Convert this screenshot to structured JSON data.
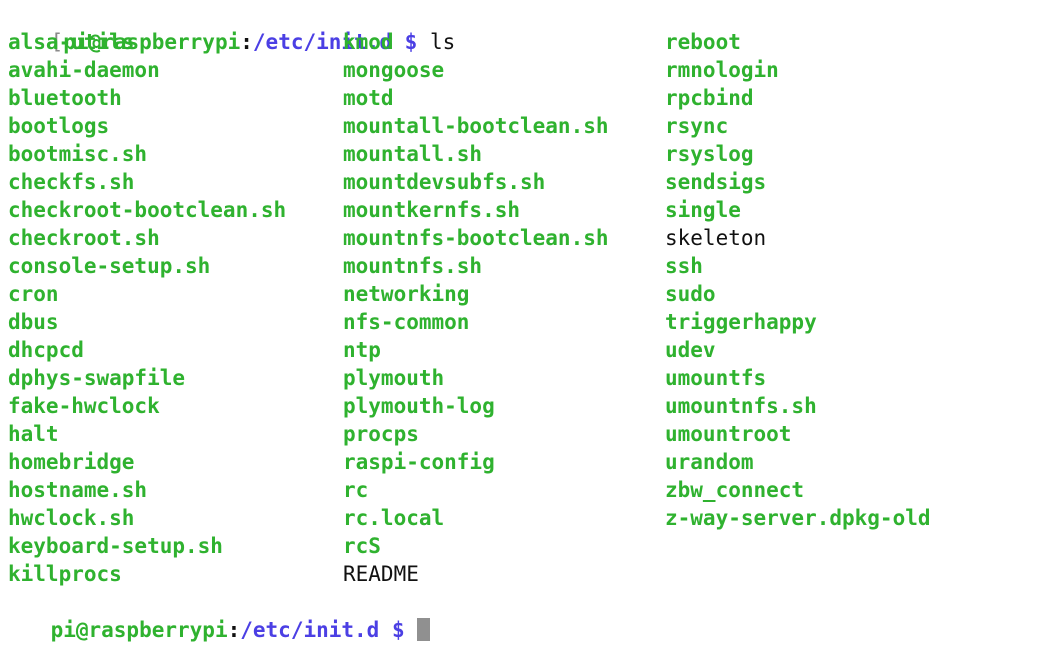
{
  "terminal": {
    "background_color": "#ffffff",
    "exec_color": "#2fb22f",
    "plain_color": "#111111",
    "path_color": "#4b3fe4",
    "cursor_color": "#909090",
    "bracket_color": "#8a8a8a"
  },
  "top_prompt": {
    "bracket": "[",
    "user_host": "pi@raspberrypi",
    "colon": ":",
    "path": "/etc/init.d",
    "space": " ",
    "dollar": "$",
    "command": " ls"
  },
  "bottom_prompt": {
    "user_host": "pi@raspberrypi",
    "colon": ":",
    "path": "/etc/init.d",
    "space": " ",
    "dollar": "$",
    "command": " "
  },
  "listing": {
    "columns": [
      {
        "name": "column-1",
        "entries": [
          {
            "text": "alsa-utils",
            "type": "exec"
          },
          {
            "text": "avahi-daemon",
            "type": "exec"
          },
          {
            "text": "bluetooth",
            "type": "exec"
          },
          {
            "text": "bootlogs",
            "type": "exec"
          },
          {
            "text": "bootmisc.sh",
            "type": "exec"
          },
          {
            "text": "checkfs.sh",
            "type": "exec"
          },
          {
            "text": "checkroot-bootclean.sh",
            "type": "exec"
          },
          {
            "text": "checkroot.sh",
            "type": "exec"
          },
          {
            "text": "console-setup.sh",
            "type": "exec"
          },
          {
            "text": "cron",
            "type": "exec"
          },
          {
            "text": "dbus",
            "type": "exec"
          },
          {
            "text": "dhcpcd",
            "type": "exec"
          },
          {
            "text": "dphys-swapfile",
            "type": "exec"
          },
          {
            "text": "fake-hwclock",
            "type": "exec"
          },
          {
            "text": "halt",
            "type": "exec"
          },
          {
            "text": "homebridge",
            "type": "exec"
          },
          {
            "text": "hostname.sh",
            "type": "exec"
          },
          {
            "text": "hwclock.sh",
            "type": "exec"
          },
          {
            "text": "keyboard-setup.sh",
            "type": "exec"
          },
          {
            "text": "killprocs",
            "type": "exec"
          }
        ]
      },
      {
        "name": "column-2",
        "entries": [
          {
            "text": "kmod",
            "type": "exec"
          },
          {
            "text": "mongoose",
            "type": "exec"
          },
          {
            "text": "motd",
            "type": "exec"
          },
          {
            "text": "mountall-bootclean.sh",
            "type": "exec"
          },
          {
            "text": "mountall.sh",
            "type": "exec"
          },
          {
            "text": "mountdevsubfs.sh",
            "type": "exec"
          },
          {
            "text": "mountkernfs.sh",
            "type": "exec"
          },
          {
            "text": "mountnfs-bootclean.sh",
            "type": "exec"
          },
          {
            "text": "mountnfs.sh",
            "type": "exec"
          },
          {
            "text": "networking",
            "type": "exec"
          },
          {
            "text": "nfs-common",
            "type": "exec"
          },
          {
            "text": "ntp",
            "type": "exec"
          },
          {
            "text": "plymouth",
            "type": "exec"
          },
          {
            "text": "plymouth-log",
            "type": "exec"
          },
          {
            "text": "procps",
            "type": "exec"
          },
          {
            "text": "raspi-config",
            "type": "exec"
          },
          {
            "text": "rc",
            "type": "exec"
          },
          {
            "text": "rc.local",
            "type": "exec"
          },
          {
            "text": "rcS",
            "type": "exec"
          },
          {
            "text": "README",
            "type": "plain"
          }
        ]
      },
      {
        "name": "column-3",
        "entries": [
          {
            "text": "reboot",
            "type": "exec"
          },
          {
            "text": "rmnologin",
            "type": "exec"
          },
          {
            "text": "rpcbind",
            "type": "exec"
          },
          {
            "text": "rsync",
            "type": "exec"
          },
          {
            "text": "rsyslog",
            "type": "exec"
          },
          {
            "text": "sendsigs",
            "type": "exec"
          },
          {
            "text": "single",
            "type": "exec"
          },
          {
            "text": "skeleton",
            "type": "plain"
          },
          {
            "text": "ssh",
            "type": "exec"
          },
          {
            "text": "sudo",
            "type": "exec"
          },
          {
            "text": "triggerhappy",
            "type": "exec"
          },
          {
            "text": "udev",
            "type": "exec"
          },
          {
            "text": "umountfs",
            "type": "exec"
          },
          {
            "text": "umountnfs.sh",
            "type": "exec"
          },
          {
            "text": "umountroot",
            "type": "exec"
          },
          {
            "text": "urandom",
            "type": "exec"
          },
          {
            "text": "zbw_connect",
            "type": "exec"
          },
          {
            "text": "z-way-server.dpkg-old",
            "type": "exec"
          },
          {
            "text": "",
            "type": "exec"
          },
          {
            "text": "",
            "type": "exec"
          }
        ]
      }
    ]
  }
}
